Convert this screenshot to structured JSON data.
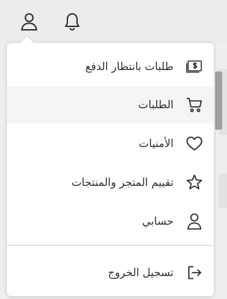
{
  "header": {
    "icons": [
      "user-icon",
      "bell-icon"
    ]
  },
  "menu": {
    "items": [
      {
        "label": "طلبات بانتظار الدفع",
        "icon": "payment-icon",
        "active": false
      },
      {
        "label": "الطلبات",
        "icon": "cart-icon",
        "active": true
      },
      {
        "label": "الأمنيات",
        "icon": "heart-icon",
        "active": false
      },
      {
        "label": "تقييم المتجر والمنتجات",
        "icon": "star-icon",
        "active": false
      },
      {
        "label": "حسابي",
        "icon": "user-icon",
        "active": false
      }
    ],
    "logout": {
      "label": "تسجيل الخروج",
      "icon": "logout-icon"
    }
  },
  "colors": {
    "background": "#eeeeee",
    "menu_bg": "#ffffff",
    "active_row": "#f5f5f5",
    "text": "#2f2f2f"
  }
}
